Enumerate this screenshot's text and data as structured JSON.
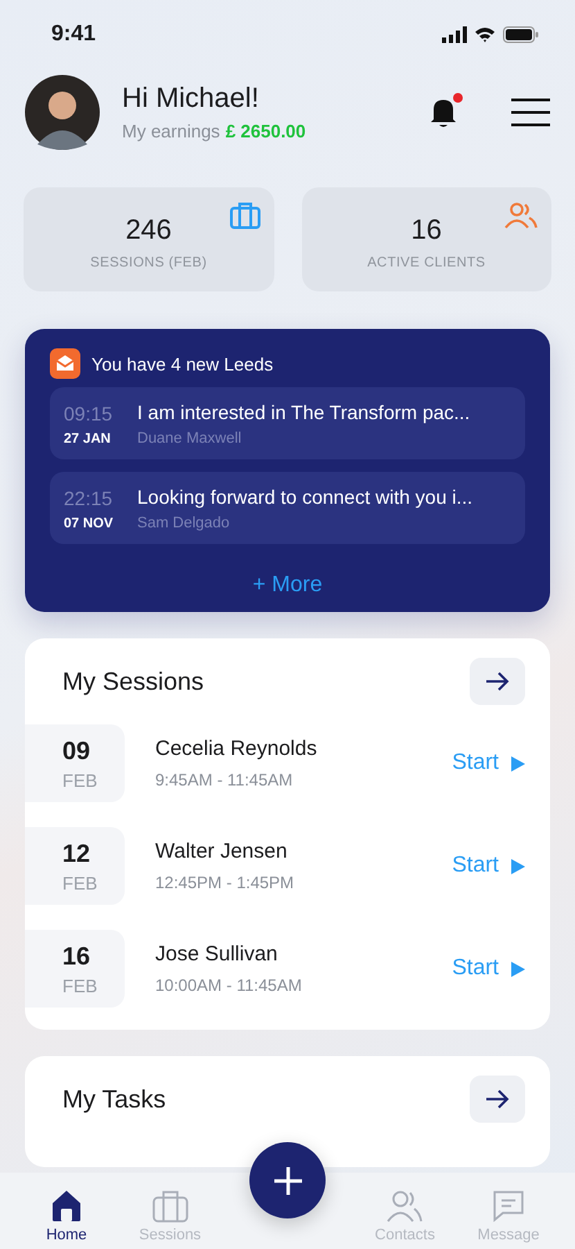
{
  "status_bar": {
    "time": "9:41"
  },
  "header": {
    "greeting": "Hi Michael!",
    "earnings_label": "My earnings",
    "earnings_value": "£ 2650.00",
    "has_notification": true
  },
  "stats": [
    {
      "value": "246",
      "label": "SESSIONS (FEB)",
      "kind": "sessions"
    },
    {
      "value": "16",
      "label": "ACTIVE CLIENTS",
      "kind": "clients"
    }
  ],
  "leads": {
    "title": "You have 4 new Leeds",
    "items": [
      {
        "time": "09:15",
        "date": "27 JAN",
        "message": "I am interested in The Transform pac...",
        "name": "Duane Maxwell"
      },
      {
        "time": "22:15",
        "date": "07 NOV",
        "message": "Looking forward to connect with you i...",
        "name": "Sam Delgado"
      }
    ],
    "more": "+ More"
  },
  "sessions": {
    "title": "My Sessions",
    "items": [
      {
        "day": "09",
        "month": "FEB",
        "name": "Cecelia Reynolds",
        "time": "9:45AM - 11:45AM",
        "action": "Start"
      },
      {
        "day": "12",
        "month": "FEB",
        "name": "Walter Jensen",
        "time": "12:45PM - 1:45PM",
        "action": "Start"
      },
      {
        "day": "16",
        "month": "FEB",
        "name": "Jose Sullivan",
        "time": "10:00AM - 11:45AM",
        "action": "Start"
      }
    ]
  },
  "tasks": {
    "title": "My Tasks"
  },
  "nav": [
    {
      "label": "Home",
      "kind": "home",
      "selected": true
    },
    {
      "label": "Sessions",
      "kind": "sessions",
      "selected": false
    },
    {
      "label": "Contacts",
      "kind": "contacts",
      "selected": false
    },
    {
      "label": "Message",
      "kind": "message",
      "selected": false
    }
  ]
}
